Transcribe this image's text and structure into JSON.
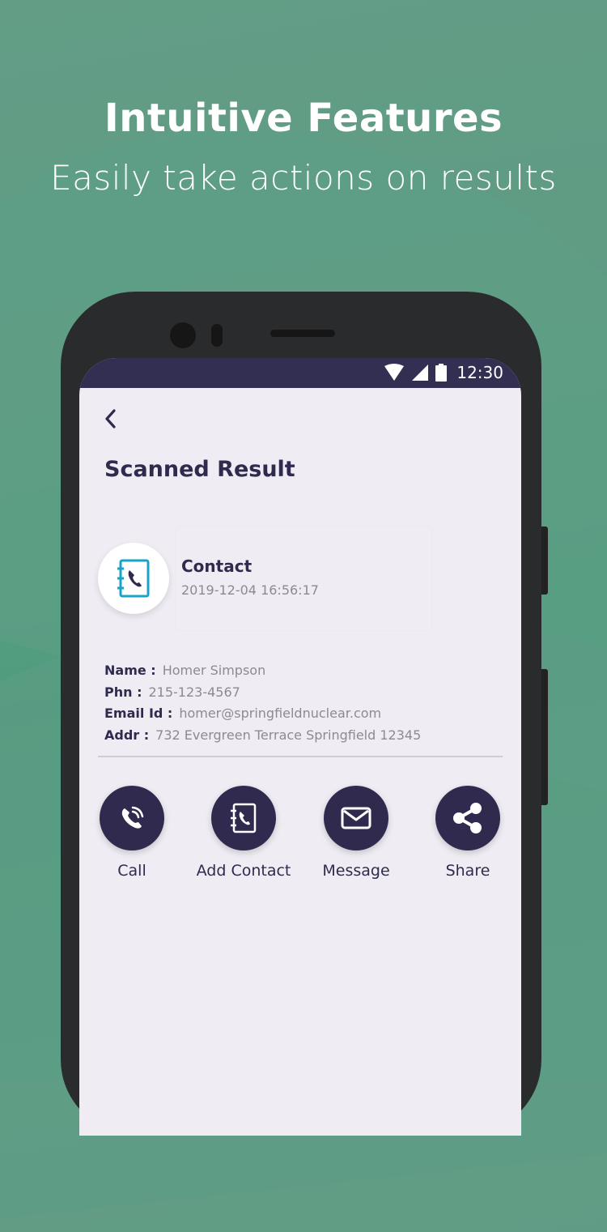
{
  "promo": {
    "title": "Intuitive Features",
    "subtitle": "Easily take actions on results"
  },
  "status_bar": {
    "time": "12:30"
  },
  "screen": {
    "title": "Scanned Result"
  },
  "result": {
    "type": "Contact",
    "timestamp": "2019-12-04 16:56:17",
    "fields": [
      {
        "label": "Name :",
        "value": "Homer Simpson"
      },
      {
        "label": "Phn :",
        "value": "215-123-4567"
      },
      {
        "label": "Email Id :",
        "value": "homer@springfieldnuclear.com"
      },
      {
        "label": "Addr :",
        "value": "732 Evergreen Terrace Springfield 12345"
      }
    ]
  },
  "actions": [
    {
      "label": "Call",
      "icon": "phone-icon"
    },
    {
      "label": "Add Contact",
      "icon": "address-book-icon"
    },
    {
      "label": "Message",
      "icon": "envelope-icon"
    },
    {
      "label": "Share",
      "icon": "share-icon"
    }
  ],
  "colors": {
    "primary": "#302b4e",
    "accent_icon": "#1aa3c8",
    "background": "#5f9d85",
    "status_bar": "#332f53"
  }
}
